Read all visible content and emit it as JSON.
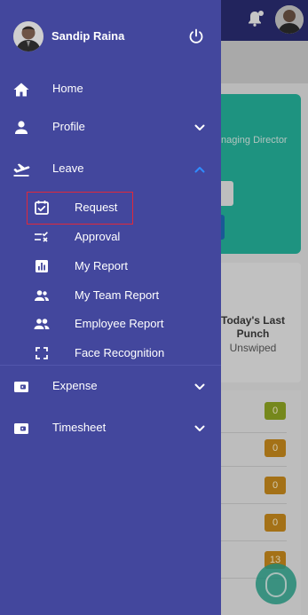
{
  "drawer": {
    "user_name": "Sandip Raina",
    "menu": {
      "home": "Home",
      "profile": "Profile",
      "leave": "Leave",
      "expense": "Expense",
      "timesheet": "Timesheet"
    },
    "leave_items": {
      "request": "Request",
      "approval": "Approval",
      "my_report": "My Report",
      "my_team_report": "My Team Report",
      "employee_report": "Employee Report",
      "face_recognition": "Face Recognition"
    }
  },
  "background": {
    "role_text": "naging Director",
    "punch_title": "Today's Last Punch",
    "punch_status": "Unswiped",
    "badges": [
      "0",
      "0",
      "0",
      "0",
      "13"
    ]
  },
  "colors": {
    "drawer_bg": "#43479d",
    "accent_chevron": "#2f8cff",
    "highlight_border": "#e0283a",
    "topbar": "#2a2c72",
    "teal_card": "#25b49d"
  }
}
